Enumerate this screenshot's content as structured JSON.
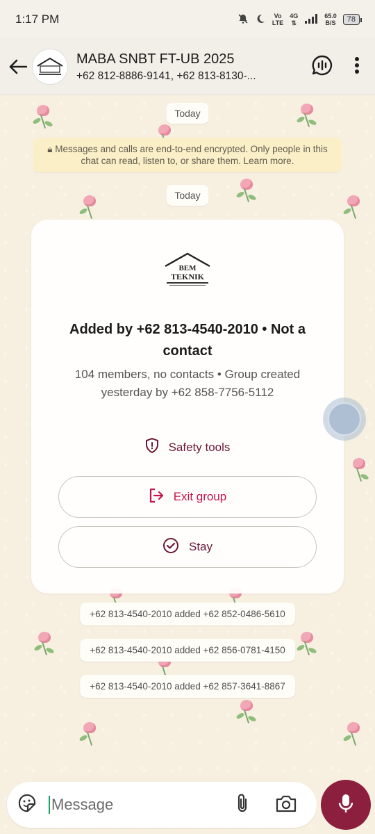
{
  "status_bar": {
    "time": "1:17 PM",
    "volte": "Vo",
    "volte2": "LTE",
    "network": "4G",
    "speed_value": "65.0",
    "speed_unit": "B/S",
    "battery": "78"
  },
  "header": {
    "title": "MABA SNBT FT-UB 2025",
    "subtitle": "+62 812-8886-9141, +62 813-8130-..."
  },
  "chat": {
    "date_chip_1": "Today",
    "encryption_note": "Messages and calls are end-to-end encrypted. Only people in this chat can read, listen to, or share them. Learn more.",
    "date_chip_2": "Today",
    "card": {
      "logo_line1": "BEM",
      "logo_line2": "TEKNIK",
      "title": "Added by +62 813-4540-2010 • Not a contact",
      "subtitle": "104 members, no contacts • Group created yesterday by +62 858-7756-5112",
      "safety_label": "Safety tools",
      "exit_label": "Exit group",
      "stay_label": "Stay"
    },
    "system_messages": [
      "+62 813-4540-2010 added +62 852-0486-5610",
      "+62 813-4540-2010 added +62 856-0781-4150",
      "+62 813-4540-2010 added +62 857-3641-8867"
    ]
  },
  "composer": {
    "placeholder": "Message"
  },
  "colors": {
    "accent": "#8c1f3e",
    "exit_red": "#c4144a",
    "encrypt_bg": "#fbefc7"
  }
}
